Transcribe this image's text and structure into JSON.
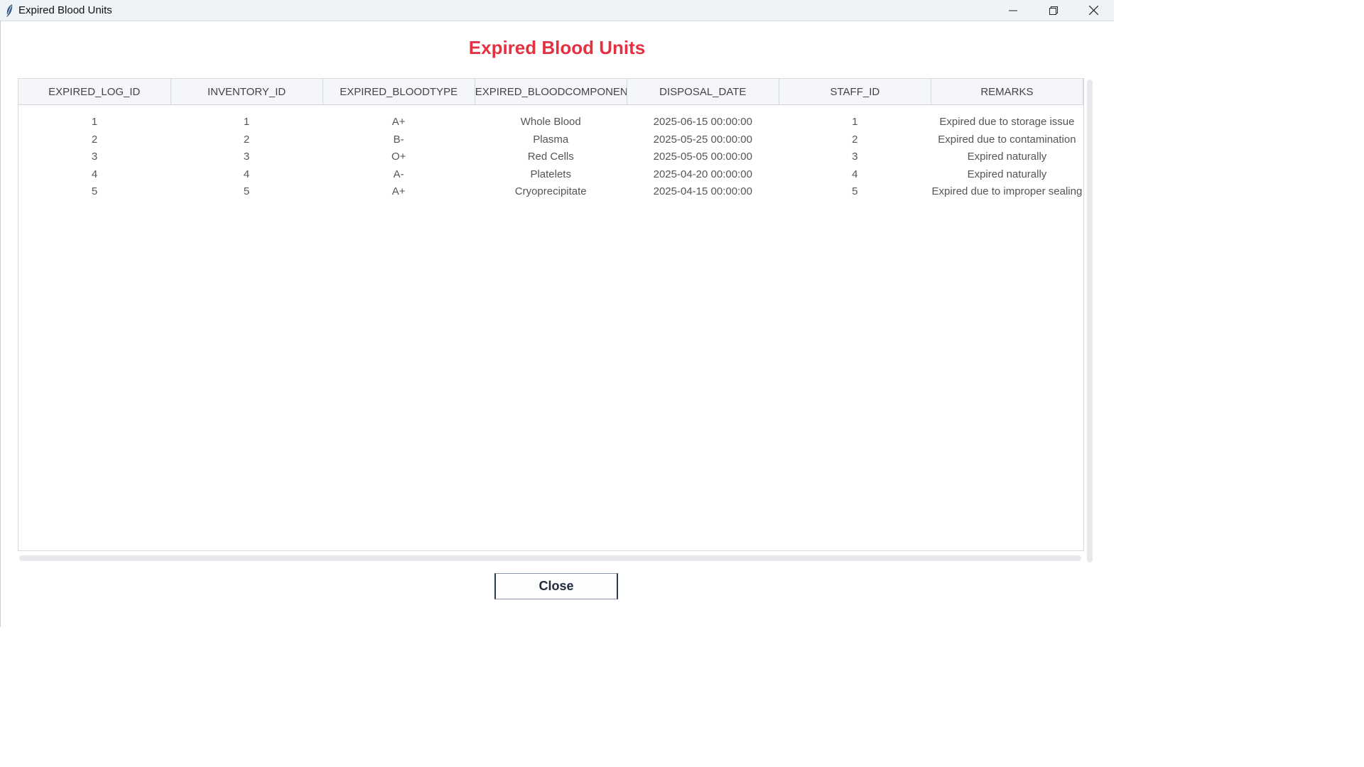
{
  "window": {
    "title": "Expired Blood Units",
    "icons": {
      "app": "feather-icon",
      "minimize": "minimize-icon",
      "maximize": "restore-icon",
      "close": "close-icon"
    }
  },
  "heading": "Expired Blood Units",
  "colors": {
    "heading": "#e53042",
    "titlebar": "#eef3f8"
  },
  "table": {
    "columns": [
      "EXPIRED_LOG_ID",
      "INVENTORY_ID",
      "EXPIRED_BLOODTYPE",
      "EXPIRED_BLOODCOMPONENT",
      "DISPOSAL_DATE",
      "STAFF_ID",
      "REMARKS"
    ],
    "rows": [
      [
        "1",
        "1",
        "A+",
        "Whole Blood",
        "2025-06-15 00:00:00",
        "1",
        "Expired due to storage issue"
      ],
      [
        "2",
        "2",
        "B-",
        "Plasma",
        "2025-05-25 00:00:00",
        "2",
        "Expired due to contamination"
      ],
      [
        "3",
        "3",
        "O+",
        "Red Cells",
        "2025-05-05 00:00:00",
        "3",
        "Expired naturally"
      ],
      [
        "4",
        "4",
        "A-",
        "Platelets",
        "2025-04-20 00:00:00",
        "4",
        "Expired naturally"
      ],
      [
        "5",
        "5",
        "A+",
        "Cryoprecipitate",
        "2025-04-15 00:00:00",
        "5",
        "Expired due to improper sealing"
      ]
    ]
  },
  "close_label": "Close"
}
